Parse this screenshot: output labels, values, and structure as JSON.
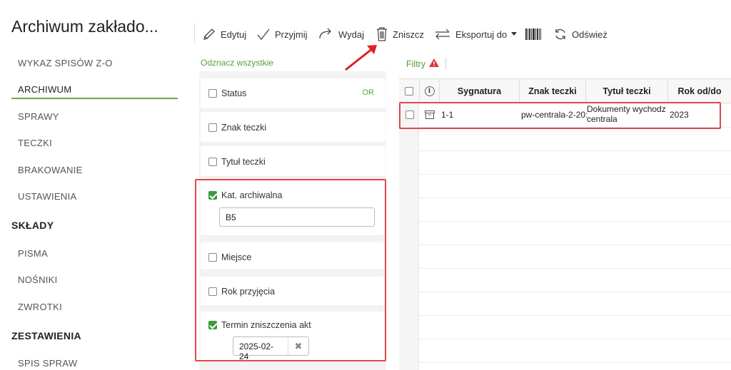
{
  "app": {
    "title": "Archiwum zakłado..."
  },
  "sidebar": {
    "items": [
      {
        "label": "WYKAZ SPISÓW Z-O"
      },
      {
        "label": "ARCHIWUM"
      },
      {
        "label": "SPRAWY"
      },
      {
        "label": "TECZKI"
      },
      {
        "label": "BRAKOWANIE"
      },
      {
        "label": "USTAWIENIA"
      }
    ],
    "section_sklady": "SKŁADY",
    "sklady_items": [
      {
        "label": "PISMA"
      },
      {
        "label": "NOŚNIKI"
      },
      {
        "label": "ZWROTKI"
      }
    ],
    "section_zestawienia": "ZESTAWIENIA",
    "zestawienia_items": [
      {
        "label": "SPIS SPRAW"
      }
    ]
  },
  "toolbar": {
    "edit": "Edytuj",
    "accept": "Przyjmij",
    "issue": "Wydaj",
    "destroy": "Zniszcz",
    "export": "Eksportuj do",
    "refresh": "Odśwież"
  },
  "filters": {
    "deselect_all": "Odznacz wszystkie",
    "or_label": "OR",
    "items": [
      {
        "label": "Status",
        "checked": false
      },
      {
        "label": "Znak teczki",
        "checked": false
      },
      {
        "label": "Tytuł teczki",
        "checked": false
      },
      {
        "label": "Kat. archiwalna",
        "checked": true,
        "value": "B5"
      },
      {
        "label": "Miejsce",
        "checked": false
      },
      {
        "label": "Rok przyjęcia",
        "checked": false
      },
      {
        "label": "Termin zniszczenia akt",
        "checked": true,
        "value": "2025-02-24"
      }
    ]
  },
  "grid": {
    "filters_label": "Filtry",
    "columns": [
      "Sygnatura",
      "Znak teczki",
      "Tytuł teczki",
      "Rok od/do"
    ],
    "rows": [
      {
        "sygnatura": "1-1",
        "znak": "pw-centrala-2-20:",
        "tytul_line1": "Dokumenty wychodz",
        "tytul_line2": "centrala",
        "rok": "2023"
      }
    ]
  },
  "colors": {
    "accent": "#6aa84f",
    "highlight": "#e04848",
    "warning": "#d9363e"
  }
}
